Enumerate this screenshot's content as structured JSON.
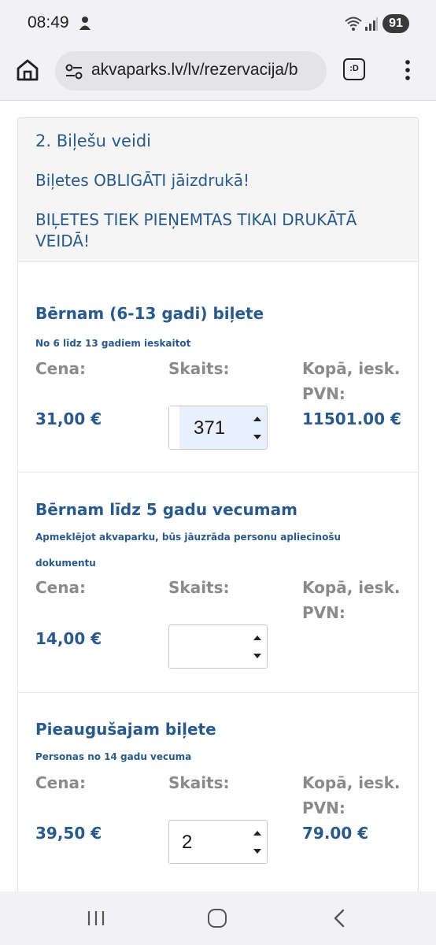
{
  "status_bar": {
    "time": "08:49",
    "battery": "91"
  },
  "browser": {
    "url": "akvaparks.lv/lv/rezervacija/b",
    "tab_label": ":D"
  },
  "section": {
    "title": "2. Biļešu veidi",
    "notice_print": "Biļetes OBLIGĀTI jāizdrukā!",
    "notice_accept": "BIĻETES TIEK PIEŅEMTAS TIKAI DRUKĀTĀ VEIDĀ!"
  },
  "labels": {
    "price": "Cena:",
    "count": "Skaits:",
    "total": "Kopā, iesk. PVN:"
  },
  "tickets": [
    {
      "name": "Bērnam (6-13 gadi) biļete",
      "description": "No 6 līdz 13 gadiem ieskaitot",
      "price": "31,00 €",
      "quantity": "371",
      "total": "11501.00 €"
    },
    {
      "name": "Bērnam līdz 5 gadu vecumam",
      "description": "Apmeklējot akvaparku, būs jāuzrāda personu apliecinošu dokumentu",
      "price": "14,00 €",
      "quantity": "",
      "total": ""
    },
    {
      "name": "Pieaugušajam biļete",
      "description": "Personas no 14 gadu vecuma",
      "price": "39,50 €",
      "quantity": "2",
      "total": "79.00 €"
    }
  ]
}
